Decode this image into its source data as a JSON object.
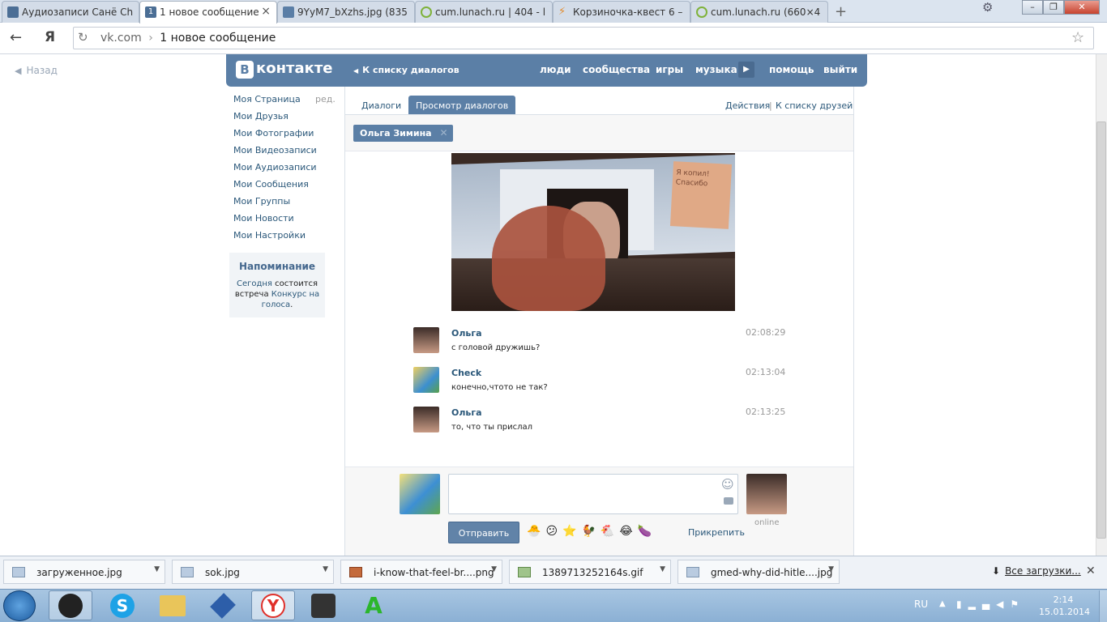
{
  "browser": {
    "tabs": [
      {
        "title": "Аудиозаписи Санё Сh",
        "active": false
      },
      {
        "title": "1 новое сообщение",
        "active": true
      },
      {
        "title": "9YyM7_bXzhs.jpg (835",
        "active": false
      },
      {
        "title": "cum.lunach.ru | 404 - l",
        "active": false
      },
      {
        "title": "Корзиночка-квест 6 –",
        "active": false
      },
      {
        "title": "cum.lunach.ru (660×4",
        "active": false
      }
    ],
    "address": {
      "domain": "vk.com",
      "separator": "›",
      "page_title": "1 новое сообщение"
    },
    "back_label": "Назад"
  },
  "vk": {
    "logo": "контакте",
    "logo_letter": "В",
    "header_back": "К списку диалогов",
    "nav": [
      "люди",
      "сообщества",
      "игры",
      "музыка",
      "помощь",
      "выйти"
    ],
    "sidebar": [
      "Моя Страница",
      "Мои Друзья",
      "Мои Фотографии",
      "Мои Видеозаписи",
      "Мои Аудиозаписи",
      "Мои Сообщения",
      "Мои Группы",
      "Мои Новости",
      "Мои Настройки"
    ],
    "edit_label": "ред.",
    "reminder": {
      "title": "Напоминание",
      "text1": "Сегодня",
      "text2": " состоится встреча ",
      "link": "Конкурс на голоса",
      "dot": "."
    },
    "tabs": {
      "dialogs": "Диалоги",
      "view": "Просмотр диалогов",
      "actions": "Действия",
      "sep": "|",
      "friends": "К списку друзей"
    },
    "chip": "Ольга Зимина",
    "photo_note": "Я копил! Спасибо",
    "messages": [
      {
        "author": "Ольга",
        "text": "с головой дружишь?",
        "time": "02:08:29"
      },
      {
        "author": "Check",
        "text": "конечно,чтото не так?",
        "time": "02:13:04"
      },
      {
        "author": "Ольга",
        "text": "то, что ты прислал",
        "time": "02:13:25"
      }
    ],
    "send_label": "Отправить",
    "attach_label": "Прикрепить",
    "online_label": "online"
  },
  "downloads": {
    "items": [
      "загруженное.jpg",
      "sok.jpg",
      "i-know-that-feel-br....png",
      "1389713252164s.gif",
      "gmed-why-did-hitle....jpg"
    ],
    "all_label": "Все загрузки..."
  },
  "taskbar": {
    "lang": "RU",
    "time": "2:14",
    "date": "15.01.2014"
  },
  "colors": {
    "vk_blue": "#5b7fa6",
    "link": "#2b587a",
    "taskbar": "#8bb0d4"
  }
}
